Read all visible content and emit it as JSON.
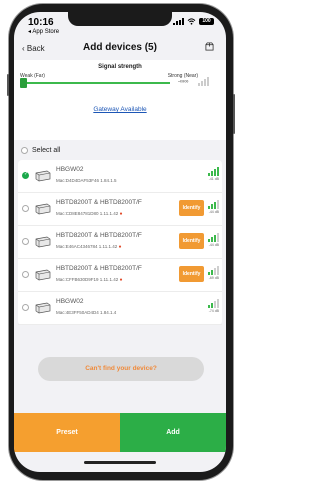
{
  "status": {
    "time": "10:16",
    "back_app": "◂ App Store",
    "battery": "100"
  },
  "nav": {
    "back_label": "Back",
    "title": "Add devices (5)"
  },
  "signal": {
    "label": "Signal strength",
    "weak_label": "Weak (Far)",
    "strong_label": "Strong (Near)",
    "end_label": "-∞∞"
  },
  "gateway_link": "Gateway Available",
  "select_all_label": "Select all",
  "devices": [
    {
      "name": "HBGW02",
      "mac": "Mac:D4D4DAF53F46  1.84.1.5",
      "checked": true,
      "identify": "",
      "db": "-41 dB"
    },
    {
      "name": "HBTD8200T & HBTD8200T/F",
      "mac": "Mac:CD8E84781D80  1.11.1.42",
      "checked": false,
      "identify": "Identify",
      "db": "-44 dB"
    },
    {
      "name": "HBTD8200T & HBTD8200T/F",
      "mac": "Mac:E46AC4346784  1.11.1.42",
      "checked": false,
      "identify": "Identify",
      "db": "-44 dB"
    },
    {
      "name": "HBTD8200T & HBTD8200T/F",
      "mac": "Mac:CFFB630D9F19  1.11.1.42",
      "checked": false,
      "identify": "Identify",
      "db": "-69 dB"
    },
    {
      "name": "HBGW02",
      "mac": "Mac:4E3FF50AD4D4  1.84.1.4",
      "checked": false,
      "identify": "",
      "db": "-74 dB"
    }
  ],
  "cant_find_label": "Can't find your device?",
  "buttons": {
    "preset": "Preset",
    "add": "Add"
  },
  "colors": {
    "accent_green": "#2cae47",
    "accent_orange": "#f59f2f",
    "link_blue": "#1c56b6"
  }
}
